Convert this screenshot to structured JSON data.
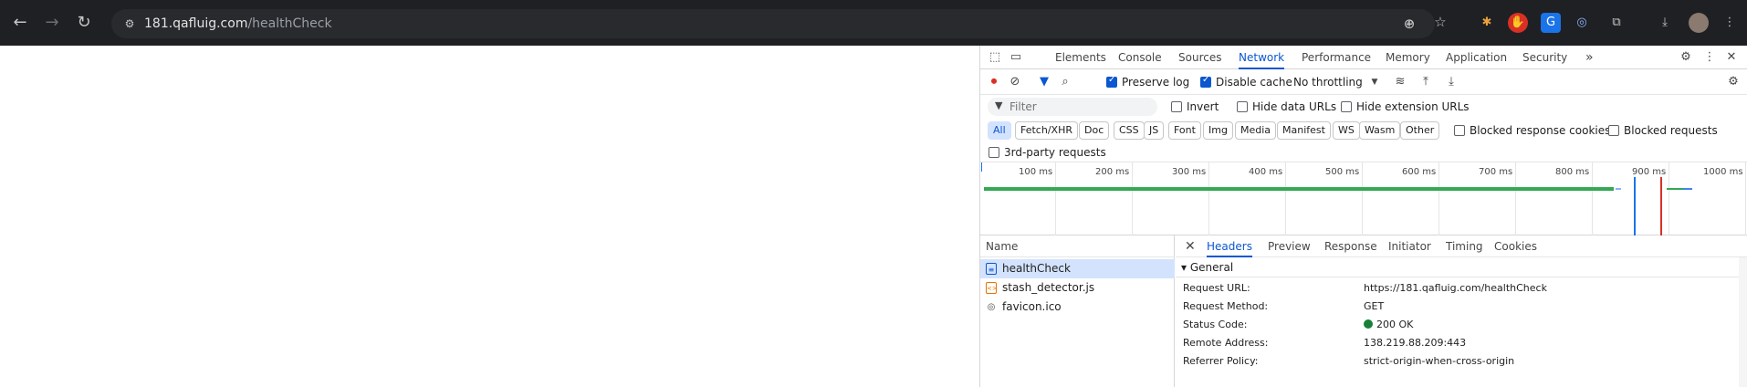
{
  "browser": {
    "url_host": "181.qafluig.com",
    "url_path": "/healthCheck"
  },
  "devtools": {
    "tabs": [
      "Elements",
      "Console",
      "Sources",
      "Network",
      "Performance",
      "Memory",
      "Application",
      "Security"
    ],
    "more_tabs": "»",
    "toolbar": {
      "preserve_log": "Preserve log",
      "disable_cache": "Disable cache",
      "throttling": "No throttling"
    },
    "filter": {
      "placeholder": "Filter",
      "invert": "Invert",
      "hide_data_urls": "Hide data URLs",
      "hide_extension_urls": "Hide extension URLs"
    },
    "type_filters": [
      "All",
      "Fetch/XHR",
      "Doc",
      "CSS",
      "JS",
      "Font",
      "Img",
      "Media",
      "Manifest",
      "WS",
      "Wasm",
      "Other"
    ],
    "blocked_response_cookies": "Blocked response cookies",
    "blocked_requests": "Blocked requests",
    "third_party": "3rd-party requests",
    "timeline_ticks": [
      "100 ms",
      "200 ms",
      "300 ms",
      "400 ms",
      "500 ms",
      "600 ms",
      "700 ms",
      "800 ms",
      "900 ms",
      "1000 ms"
    ],
    "name_header": "Name",
    "requests": [
      {
        "name": "healthCheck",
        "icon": "document-icon",
        "selected": true
      },
      {
        "name": "stash_detector.js",
        "icon": "script-icon",
        "selected": false
      },
      {
        "name": "favicon.ico",
        "icon": "image-icon",
        "selected": false
      }
    ],
    "detail_tabs": [
      "Headers",
      "Preview",
      "Response",
      "Initiator",
      "Timing",
      "Cookies"
    ],
    "general_label": "General",
    "general": [
      {
        "key": "Request URL:",
        "value": "https://181.qafluig.com/healthCheck"
      },
      {
        "key": "Request Method:",
        "value": "GET"
      },
      {
        "key": "Status Code:",
        "value": "200 OK"
      },
      {
        "key": "Remote Address:",
        "value": "138.219.88.209:443"
      },
      {
        "key": "Referrer Policy:",
        "value": "strict-origin-when-cross-origin"
      }
    ]
  }
}
